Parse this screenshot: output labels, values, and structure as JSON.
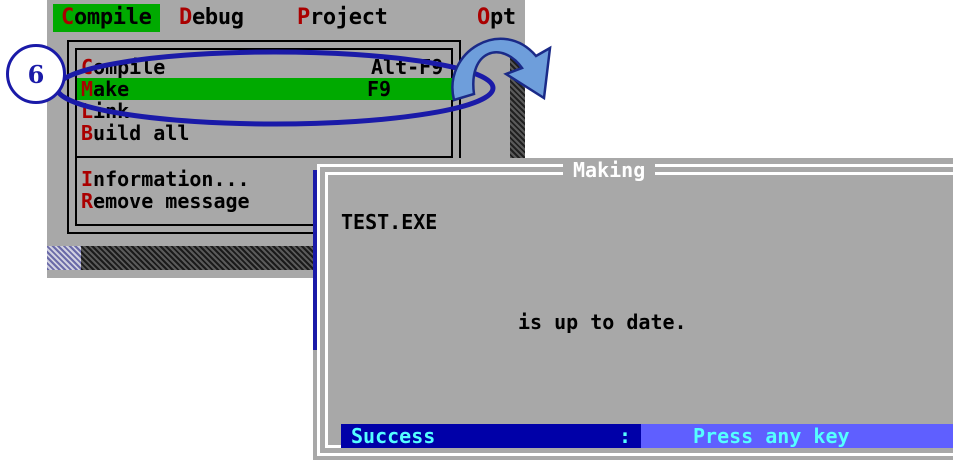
{
  "step_number": "6",
  "menubar": {
    "items": [
      {
        "hot": "C",
        "rest": "ompile"
      },
      {
        "hot": "D",
        "rest": "ebug"
      },
      {
        "hot": "P",
        "rest": "roject"
      },
      {
        "hot": "O",
        "rest": "pt"
      }
    ]
  },
  "compile_menu": {
    "items": [
      {
        "hot": "C",
        "rest": "ompile",
        "shortcut": "Alt-F9"
      },
      {
        "hot": "M",
        "rest": "ake",
        "shortcut": "F9"
      },
      {
        "hot": "L",
        "rest": "ink",
        "shortcut": ""
      },
      {
        "hot": "B",
        "rest": "uild all",
        "shortcut": ""
      },
      {
        "hot": "I",
        "rest": "nformation...",
        "shortcut": ""
      },
      {
        "hot": "R",
        "rest": "emove message",
        "shortcut": ""
      }
    ],
    "selected_index": 1
  },
  "dialog": {
    "title": "Making",
    "filename": "TEST.EXE",
    "message": "is up to date.",
    "status": {
      "result": "Success",
      "separator": ":",
      "prompt": "Press any key"
    }
  },
  "colors": {
    "menu_bg": "#a8a8a8",
    "highlight_green": "#00aa00",
    "hotkey_red": "#aa0000",
    "callout_blue": "#1a1aa8",
    "status_dark": "#0000a8",
    "status_light": "#5f5fff",
    "status_text": "#55ffff"
  }
}
